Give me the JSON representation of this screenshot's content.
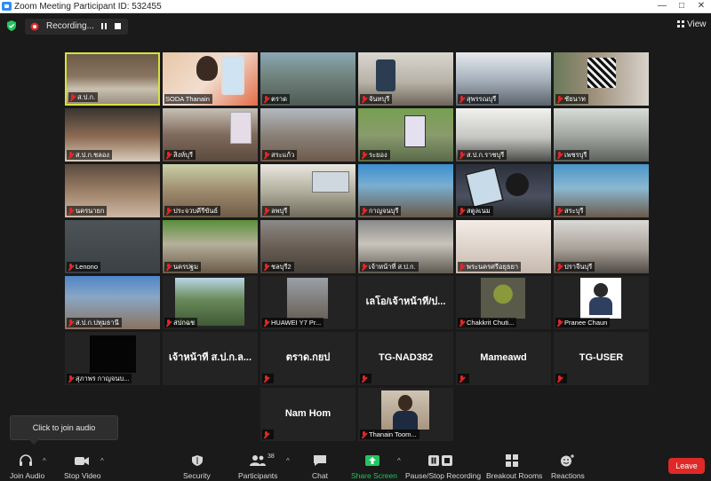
{
  "window": {
    "title": "Zoom Meeting Participant ID: 532455"
  },
  "topbar": {
    "recording_label": "Recording...",
    "view_label": "View"
  },
  "participants": {
    "r1": [
      "ส.ป.ก.",
      "SODA Thanain",
      "ตราด",
      "จันทบุรี",
      "สุพรรณบุรี",
      "ชัยนาท"
    ],
    "r2": [
      "ส.ป.ก.ชลอง",
      "สิงห์บุรี",
      "สระแก้ว",
      "ระยอง",
      "ส.ป.ก.ราชบุรี",
      "เพชรบุรี"
    ],
    "r3": [
      "นครนายก",
      "ประจวบคีรีขันธ์",
      "ลพบุรี",
      "กาญจนบุรี",
      "สตูลเนม",
      "สระบุรี"
    ],
    "r4": [
      "Lenono",
      "นครปฐม",
      "ชลบุรี2",
      "เจ้าหน้าที่ ส.ป.ก.",
      "พระนครศรีอยุธยา",
      "ปราจีนบุรี"
    ],
    "r5": [
      "ส.ป.ก.ปทุมธานี",
      "สปกฉช",
      "HUAWEI Y7 Pr...",
      "เลโอ/เจ้าหน้าที่/ป...",
      "Chakkrit Chuti...",
      "Pranee Chaun"
    ],
    "r6": [
      "สุภาพร กาญจนบ...",
      "เจ้าหน้าที่ ส.ป.ก.ล...",
      "ตราด.กยป",
      "TG-NAD382",
      "Mameawd",
      "TG-USER"
    ],
    "r7": [
      "Nam Hom",
      "Thanain Toom..."
    ]
  },
  "popup": {
    "text": "Click to join audio"
  },
  "toolbar": {
    "join_audio": "Join Audio",
    "stop_video": "Stop Video",
    "security": "Security",
    "participants": "Participants",
    "participants_count": "38",
    "chat": "Chat",
    "share_screen": "Share Screen",
    "recording": "Pause/Stop Recording",
    "breakout": "Breakout Rooms",
    "reactions": "Reactions",
    "leave": "Leave"
  },
  "colors": {
    "active_speaker": "#d6e23c",
    "share_green": "#22c55e",
    "leave_red": "#e02828",
    "mute_red": "#e02828"
  }
}
